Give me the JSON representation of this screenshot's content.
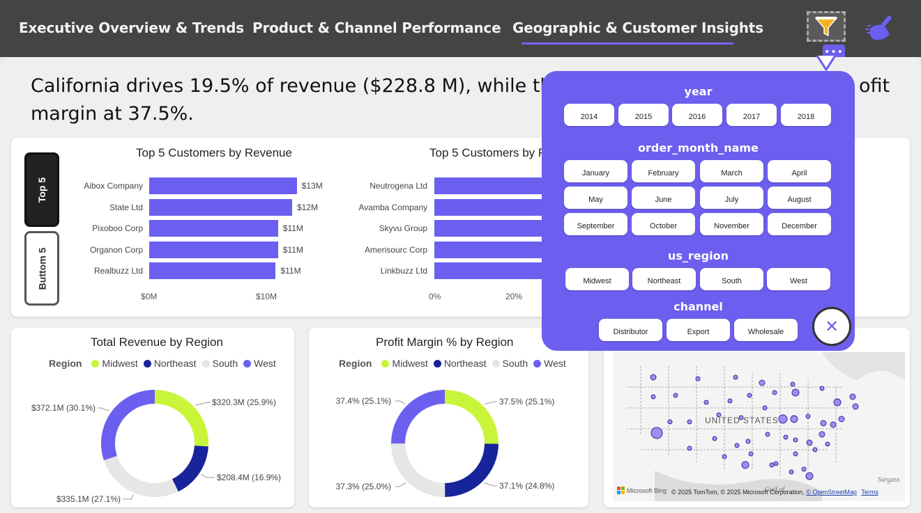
{
  "nav": {
    "tabs": [
      "Executive Overview & Trends",
      "Product & Channel Performance",
      "Geographic & Customer Insights"
    ],
    "active_tab": "Geographic & Customer Insights"
  },
  "icons": {
    "filter": "funnel-icon",
    "clear": "eraser-broom-icon",
    "more": "more-options-icon",
    "close": "close-icon"
  },
  "headline": "California drives 19.5% of revenue ($228.8 M), while the ",
  "headline_tail": "ofit",
  "headline_line2": "margin at 37.5%.",
  "toggle": {
    "top": "Top 5",
    "bottom": "Buttom 5"
  },
  "colors": {
    "accent": "#6b5ff0",
    "midwest": "#c8f53a",
    "northeast": "#17249a",
    "south": "#e6e6e6",
    "west": "#6b5ff0"
  },
  "chart_data": [
    {
      "type": "bar",
      "title": "Top 5 Customers by Revenue",
      "categories": [
        "Aibox Company",
        "State Ltd",
        "Pixoboo Corp",
        "Organon Corp",
        "Realbuzz Ltd"
      ],
      "values": [
        12.6,
        12.2,
        11.0,
        11.0,
        10.8
      ],
      "value_labels": [
        "$13M",
        "$12M",
        "$11M",
        "$11M",
        "$11M"
      ],
      "x_ticks": [
        "$0M",
        "$10M"
      ],
      "xlim": [
        0,
        15
      ]
    },
    {
      "type": "bar",
      "title": "Top 5 Customers by R",
      "categories": [
        "Neutrogena Ltd",
        "Avamba Company",
        "Skyvu Group",
        "Amerisourc Corp",
        "Linkbuzz Ltd"
      ],
      "x_ticks": [
        "0%",
        "20%"
      ]
    },
    {
      "type": "pie",
      "title": "Total Revenue by Region",
      "legend_title": "Region",
      "categories": [
        "Midwest",
        "Northeast",
        "South",
        "West"
      ],
      "values": [
        320.3,
        208.4,
        335.1,
        372.1
      ],
      "labels": [
        "$320.3M (25.9%)",
        "$208.4M (16.9%)",
        "$335.1M (27.1%)",
        "$372.1M (30.1%)"
      ]
    },
    {
      "type": "pie",
      "title": "Profit Margin % by Region",
      "legend_title": "Region",
      "categories": [
        "Midwest",
        "Northeast",
        "South",
        "West"
      ],
      "values": [
        37.5,
        37.1,
        37.3,
        37.4
      ],
      "labels": [
        "37.5% (25.1%)",
        "37.1% (24.8%)",
        "37.3% (25.0%)",
        "37.4% (25.1%)"
      ]
    }
  ],
  "map": {
    "country_label": "UNITED STATES",
    "gulf_label": "Gulf of",
    "corner_label": "Sargass",
    "attribution": "© 2025 TomTom, © 2025 Microsoft Corporation,",
    "osm_link": "© OpenStreetMap",
    "terms_link": "Terms",
    "brand": "Microsoft Bing"
  },
  "filter_panel": {
    "year": {
      "heading": "year",
      "options": [
        "2014",
        "2015",
        "2016",
        "2017",
        "2018"
      ]
    },
    "month": {
      "heading": "order_month_name",
      "options": [
        "January",
        "February",
        "March",
        "April",
        "May",
        "June",
        "July",
        "August",
        "September",
        "October",
        "November",
        "December"
      ]
    },
    "region": {
      "heading": "us_region",
      "options": [
        "Midwest",
        "Northeast",
        "South",
        "West"
      ]
    },
    "channel": {
      "heading": "channel",
      "options": [
        "Distributor",
        "Export",
        "Wholesale"
      ]
    },
    "close": "✕"
  }
}
